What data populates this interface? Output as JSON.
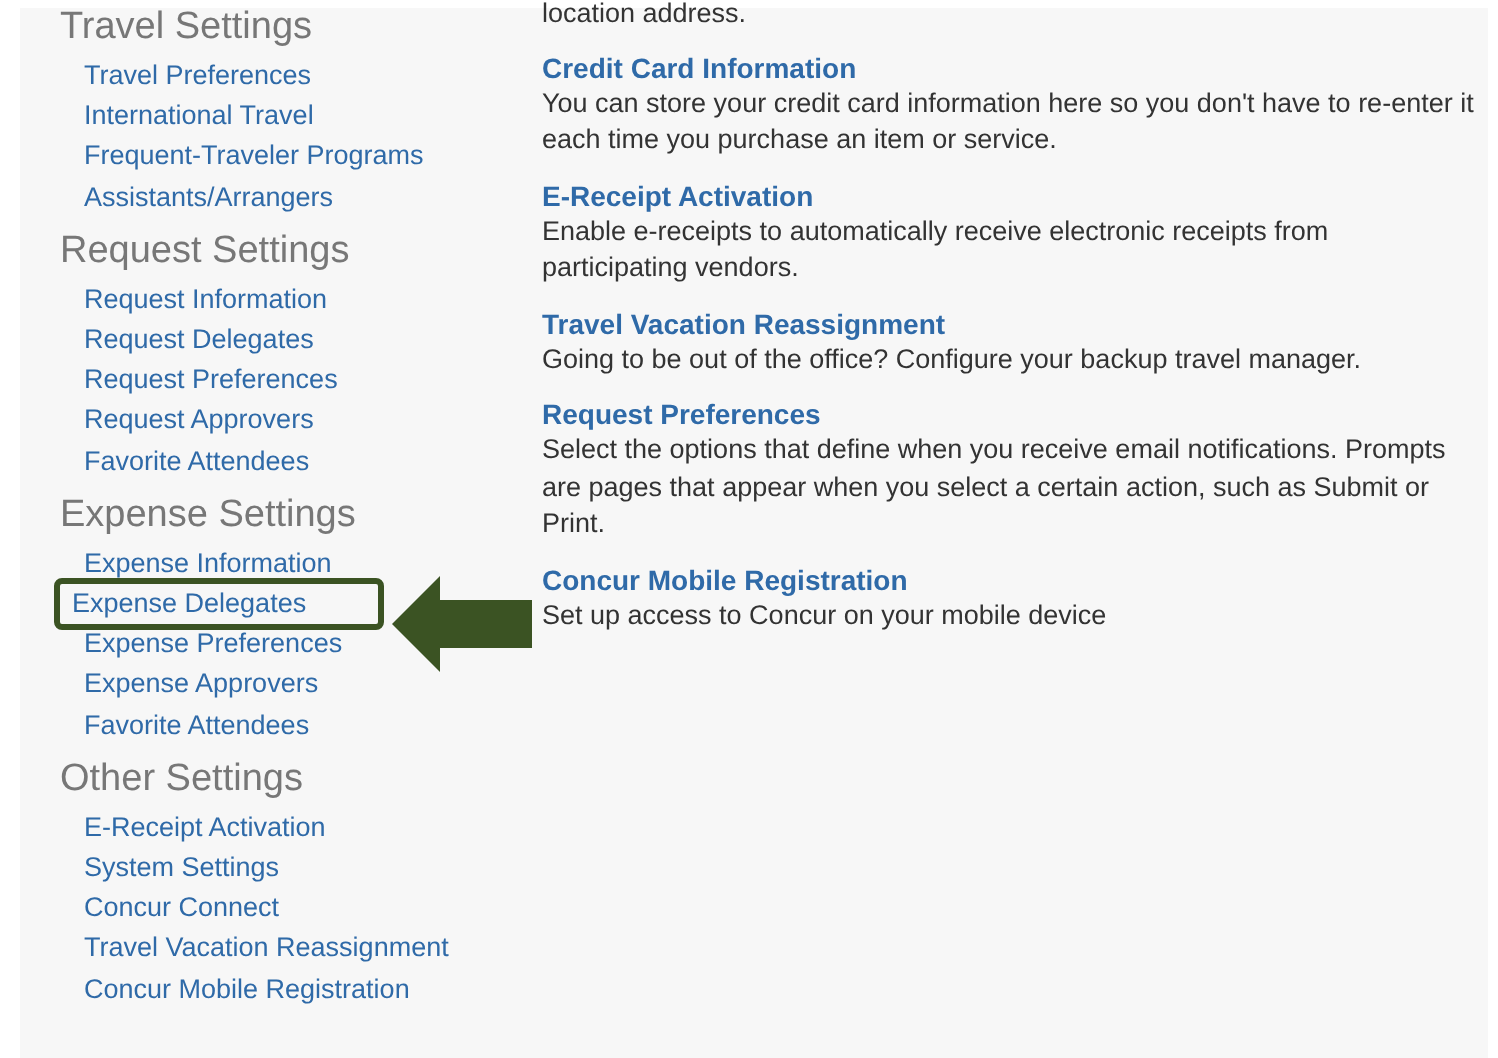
{
  "sidebar": {
    "sections": [
      {
        "heading": "Travel Settings",
        "items": [
          {
            "label": "Travel Preferences",
            "highlighted": false
          },
          {
            "label": "International Travel",
            "highlighted": false
          },
          {
            "label": "Frequent-Traveler Programs",
            "highlighted": false
          },
          {
            "label": "Assistants/Arrangers",
            "highlighted": false
          }
        ]
      },
      {
        "heading": "Request Settings",
        "items": [
          {
            "label": "Request Information",
            "highlighted": false
          },
          {
            "label": "Request Delegates",
            "highlighted": false
          },
          {
            "label": "Request Preferences",
            "highlighted": false
          },
          {
            "label": "Request Approvers",
            "highlighted": false
          },
          {
            "label": "Favorite Attendees",
            "highlighted": false
          }
        ]
      },
      {
        "heading": "Expense Settings",
        "items": [
          {
            "label": "Expense Information",
            "highlighted": false
          },
          {
            "label": "Expense Delegates",
            "highlighted": true
          },
          {
            "label": "Expense Preferences",
            "highlighted": false
          },
          {
            "label": "Expense Approvers",
            "highlighted": false
          },
          {
            "label": "Favorite Attendees",
            "highlighted": false
          }
        ]
      },
      {
        "heading": "Other Settings",
        "items": [
          {
            "label": "E-Receipt Activation",
            "highlighted": false
          },
          {
            "label": "System Settings",
            "highlighted": false
          },
          {
            "label": "Concur Connect",
            "highlighted": false
          },
          {
            "label": "Travel Vacation Reassignment",
            "highlighted": false
          },
          {
            "label": "Concur Mobile Registration",
            "highlighted": false
          }
        ]
      }
    ]
  },
  "content": {
    "lead_text": "location address.",
    "entries": [
      {
        "title": "Credit Card Information",
        "description": "You can store your credit card information here so you don't have to re-enter it each time you purchase an item or service."
      },
      {
        "title": "E-Receipt Activation",
        "description": "Enable e-receipts to automatically receive electronic receipts from participating vendors."
      },
      {
        "title": "Travel Vacation Reassignment",
        "description": "Going to be out of the office? Configure your backup travel manager."
      },
      {
        "title": "Request Preferences",
        "description": "Select the options that define when you receive email notifications. Prompts are pages that appear when you select a certain action, such as Submit or Print."
      },
      {
        "title": "Concur Mobile Registration",
        "description": "Set up access to Concur on your mobile device"
      }
    ]
  }
}
